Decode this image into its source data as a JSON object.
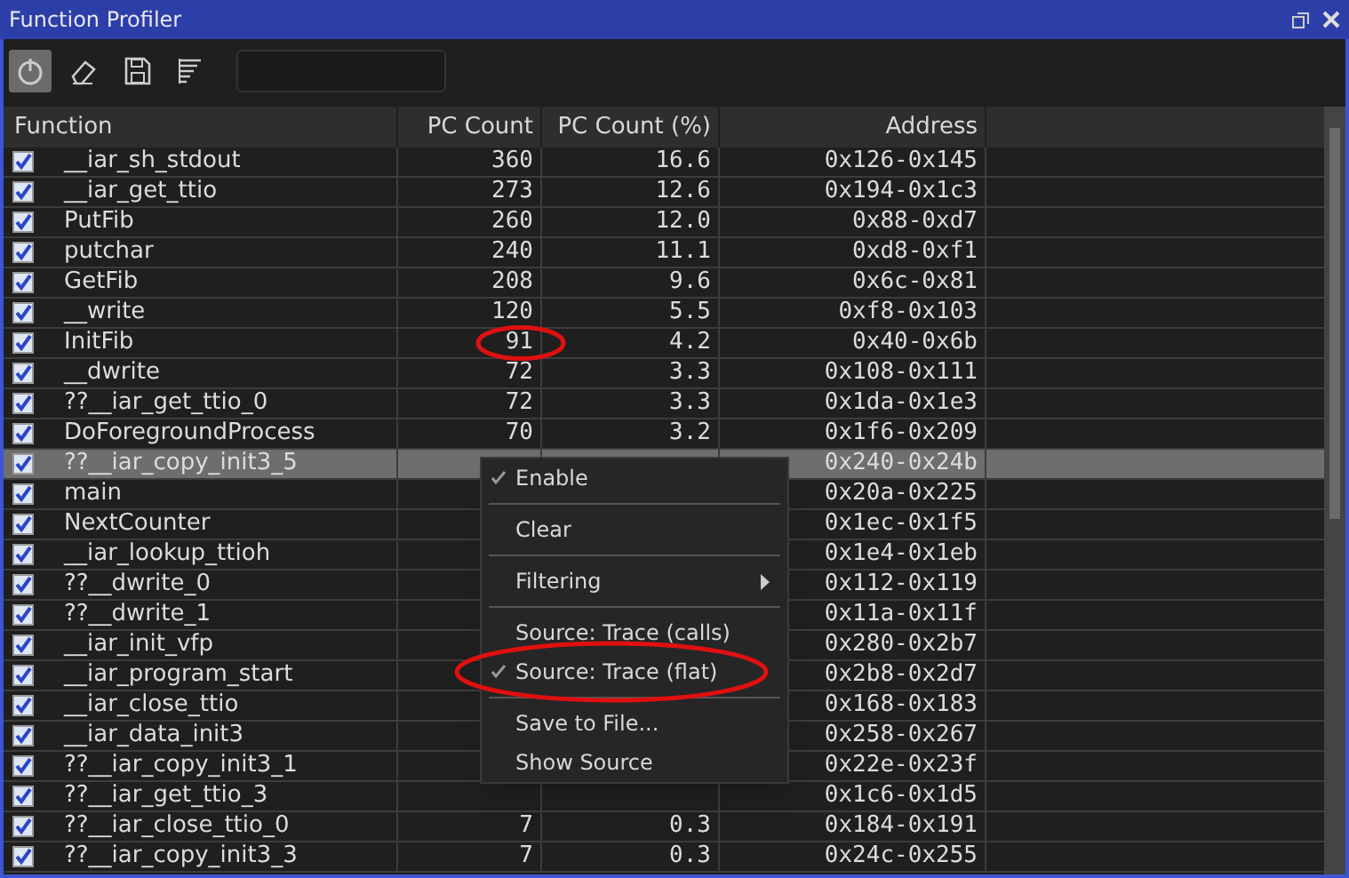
{
  "window": {
    "title": "Function Profiler"
  },
  "toolbar": {
    "buttons": [
      {
        "kind": "power",
        "selected": true
      },
      {
        "kind": "eraser",
        "selected": false
      },
      {
        "kind": "save",
        "selected": false
      },
      {
        "kind": "filter",
        "selected": false
      }
    ]
  },
  "table": {
    "columns": [
      "Function",
      "PC Count",
      "PC Count (%)",
      "Address"
    ],
    "rows": [
      {
        "checked": true,
        "selected": false,
        "cells": [
          "__iar_sh_stdout",
          "360",
          "16.6",
          "0x126-0x145"
        ]
      },
      {
        "checked": true,
        "selected": false,
        "cells": [
          "__iar_get_ttio",
          "273",
          "12.6",
          "0x194-0x1c3"
        ]
      },
      {
        "checked": true,
        "selected": false,
        "cells": [
          "PutFib",
          "260",
          "12.0",
          "0x88-0xd7"
        ]
      },
      {
        "checked": true,
        "selected": false,
        "cells": [
          "putchar",
          "240",
          "11.1",
          "0xd8-0xf1"
        ]
      },
      {
        "checked": true,
        "selected": false,
        "cells": [
          "GetFib",
          "208",
          "9.6",
          "0x6c-0x81"
        ]
      },
      {
        "checked": true,
        "selected": false,
        "cells": [
          "__write",
          "120",
          "5.5",
          "0xf8-0x103"
        ]
      },
      {
        "checked": true,
        "selected": false,
        "circled": true,
        "cells": [
          "InitFib",
          "91",
          "4.2",
          "0x40-0x6b"
        ]
      },
      {
        "checked": true,
        "selected": false,
        "cells": [
          "__dwrite",
          "72",
          "3.3",
          "0x108-0x111"
        ]
      },
      {
        "checked": true,
        "selected": false,
        "cells": [
          "??__iar_get_ttio_0",
          "72",
          "3.3",
          "0x1da-0x1e3"
        ]
      },
      {
        "checked": true,
        "selected": false,
        "cells": [
          "DoForegroundProcess",
          "70",
          "3.2",
          "0x1f6-0x209"
        ]
      },
      {
        "checked": true,
        "selected": true,
        "cells": [
          "??__iar_copy_init3_5",
          "",
          "",
          "0x240-0x24b"
        ]
      },
      {
        "checked": true,
        "selected": false,
        "cells": [
          "main",
          "",
          "",
          "0x20a-0x225"
        ]
      },
      {
        "checked": true,
        "selected": false,
        "cells": [
          "NextCounter",
          "",
          "",
          "0x1ec-0x1f5"
        ]
      },
      {
        "checked": true,
        "selected": false,
        "cells": [
          "__iar_lookup_ttioh",
          "",
          "",
          "0x1e4-0x1eb"
        ]
      },
      {
        "checked": true,
        "selected": false,
        "cells": [
          "??__dwrite_0",
          "",
          "",
          "0x112-0x119"
        ]
      },
      {
        "checked": true,
        "selected": false,
        "cells": [
          "??__dwrite_1",
          "",
          "",
          "0x11a-0x11f"
        ]
      },
      {
        "checked": true,
        "selected": false,
        "cells": [
          "__iar_init_vfp",
          "",
          "",
          "0x280-0x2b7"
        ]
      },
      {
        "checked": true,
        "selected": false,
        "cells": [
          "__iar_program_start",
          "",
          "",
          "0x2b8-0x2d7"
        ]
      },
      {
        "checked": true,
        "selected": false,
        "cells": [
          "__iar_close_ttio",
          "",
          "",
          "0x168-0x183"
        ]
      },
      {
        "checked": true,
        "selected": false,
        "cells": [
          "__iar_data_init3",
          "",
          "",
          "0x258-0x267"
        ]
      },
      {
        "checked": true,
        "selected": false,
        "cells": [
          "??__iar_copy_init3_1",
          "",
          "",
          "0x22e-0x23f"
        ]
      },
      {
        "checked": true,
        "selected": false,
        "cells": [
          "??__iar_get_ttio_3",
          "",
          "",
          "0x1c6-0x1d5"
        ]
      },
      {
        "checked": true,
        "selected": false,
        "cells": [
          "??__iar_close_ttio_0",
          "7",
          "0.3",
          "0x184-0x191"
        ]
      },
      {
        "checked": true,
        "selected": false,
        "cells": [
          "??__iar_copy_init3_3",
          "7",
          "0.3",
          "0x24c-0x255"
        ]
      }
    ]
  },
  "context_menu": {
    "items": [
      {
        "kind": "item",
        "label": "Enable",
        "checked": true
      },
      {
        "kind": "separator"
      },
      {
        "kind": "item",
        "label": "Clear",
        "checked": false
      },
      {
        "kind": "separator"
      },
      {
        "kind": "submenu",
        "label": "Filtering",
        "checked": false
      },
      {
        "kind": "separator"
      },
      {
        "kind": "item",
        "label": "Source: Trace (calls)",
        "checked": false
      },
      {
        "kind": "item",
        "label": "Source: Trace (flat)",
        "checked": true,
        "circled": true
      },
      {
        "kind": "separator"
      },
      {
        "kind": "item",
        "label": "Save to File...",
        "checked": false
      },
      {
        "kind": "item",
        "label": "Show Source",
        "checked": false
      }
    ]
  }
}
